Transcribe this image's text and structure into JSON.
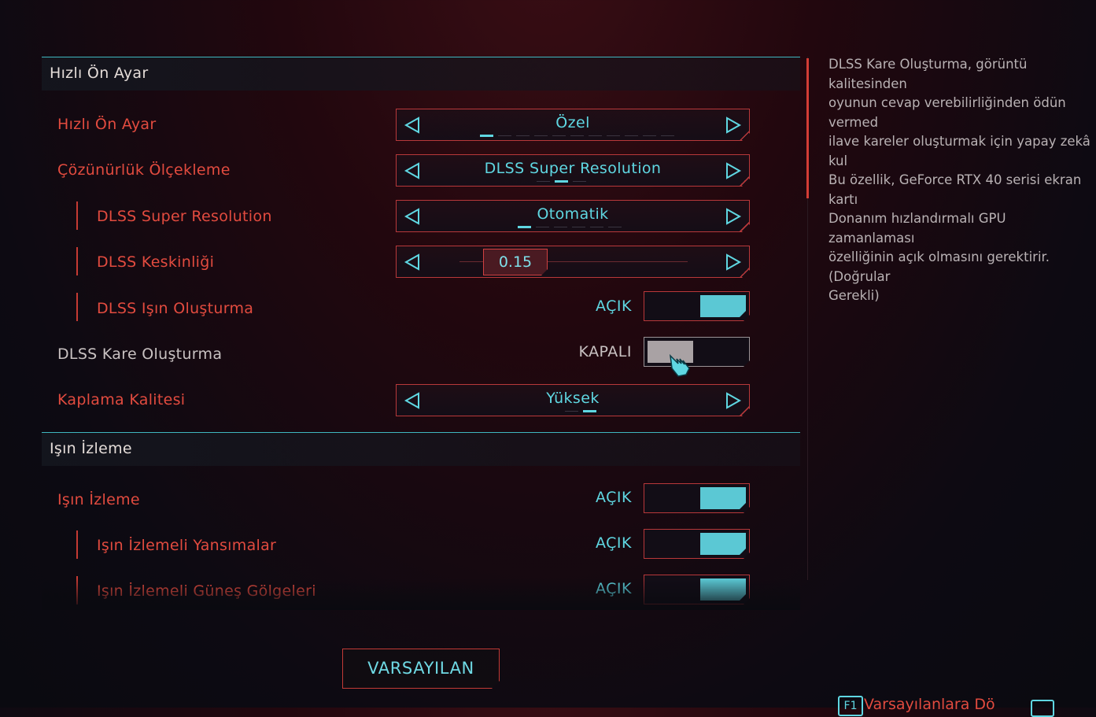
{
  "sections": {
    "quick_preset": "Hızlı Ön Ayar",
    "ray_tracing": "Işın İzleme"
  },
  "rows": {
    "quick_preset": {
      "label": "Hızlı Ön Ayar",
      "value": "Özel"
    },
    "resolution_scaling": {
      "label": "Çözünürlük Ölçekleme",
      "value": "DLSS Super Resolution"
    },
    "dlss_sr": {
      "label": "DLSS Super Resolution",
      "value": "Otomatik"
    },
    "dlss_sharpness": {
      "label": "DLSS Keskinliği",
      "value": "0.15"
    },
    "dlss_ray_reconstruction": {
      "label": "DLSS Işın Oluşturma",
      "state": "AÇIK"
    },
    "dlss_frame_gen": {
      "label": "DLSS Kare Oluşturma",
      "state": "KAPALI"
    },
    "texture_quality": {
      "label": "Kaplama Kalitesi",
      "value": "Yüksek"
    },
    "ray_tracing": {
      "label": "Işın İzleme",
      "state": "AÇIK"
    },
    "rt_reflections": {
      "label": "Işın İzlemeli Yansımalar",
      "state": "AÇIK"
    },
    "rt_sun_shadows": {
      "label": "Işın İzlemeli Güneş Gölgeleri",
      "state": "AÇIK"
    }
  },
  "description": "DLSS Kare Oluşturma, görüntü kalitesinden\noyunun cevap verebilirliğinden ödün vermed\nilave kareler oluşturmak için yapay zekâ kul\nBu özellik, GeForce RTX 40 serisi ekran kartı\nDonanım hızlandırmalı GPU zamanlaması\nözelliğinin açık olmasını gerektirir. (Doğrular\nGerekli)",
  "buttons": {
    "default": "VARSAYILAN"
  },
  "hints": {
    "f1_key": "F1",
    "f1_text": "Varsayılanlara Dö"
  },
  "colors": {
    "accent_cyan": "#5fd7e2",
    "accent_red": "#e24b3f",
    "toggle_on": "#5bc8d4"
  }
}
